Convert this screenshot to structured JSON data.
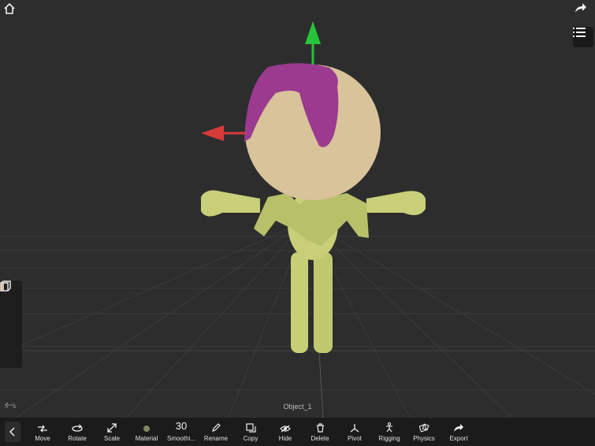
{
  "scene": {
    "object_name": "Object_1",
    "colors": {
      "background": "#2d2d2d",
      "grid": "#3e3e3e",
      "head": "#d9c39a",
      "body": "#c9cf78",
      "hair": "#9b3a8f",
      "axis_x": "#d93a3a",
      "axis_y": "#26c43a"
    }
  },
  "top": {
    "home_icon": "home-icon",
    "share_icon": "share-icon",
    "list_icon": "list-icon"
  },
  "toolbar": {
    "items": [
      {
        "label": "Move"
      },
      {
        "label": "Rotate"
      },
      {
        "label": "Scale"
      },
      {
        "label": "Material"
      },
      {
        "label": "Smoothi...",
        "value": "30"
      },
      {
        "label": "Rename"
      },
      {
        "label": "Copy"
      },
      {
        "label": "Hide"
      },
      {
        "label": "Delete"
      },
      {
        "label": "Pivot"
      },
      {
        "label": "Rigging"
      },
      {
        "label": "Physics"
      },
      {
        "label": "Export"
      }
    ]
  }
}
